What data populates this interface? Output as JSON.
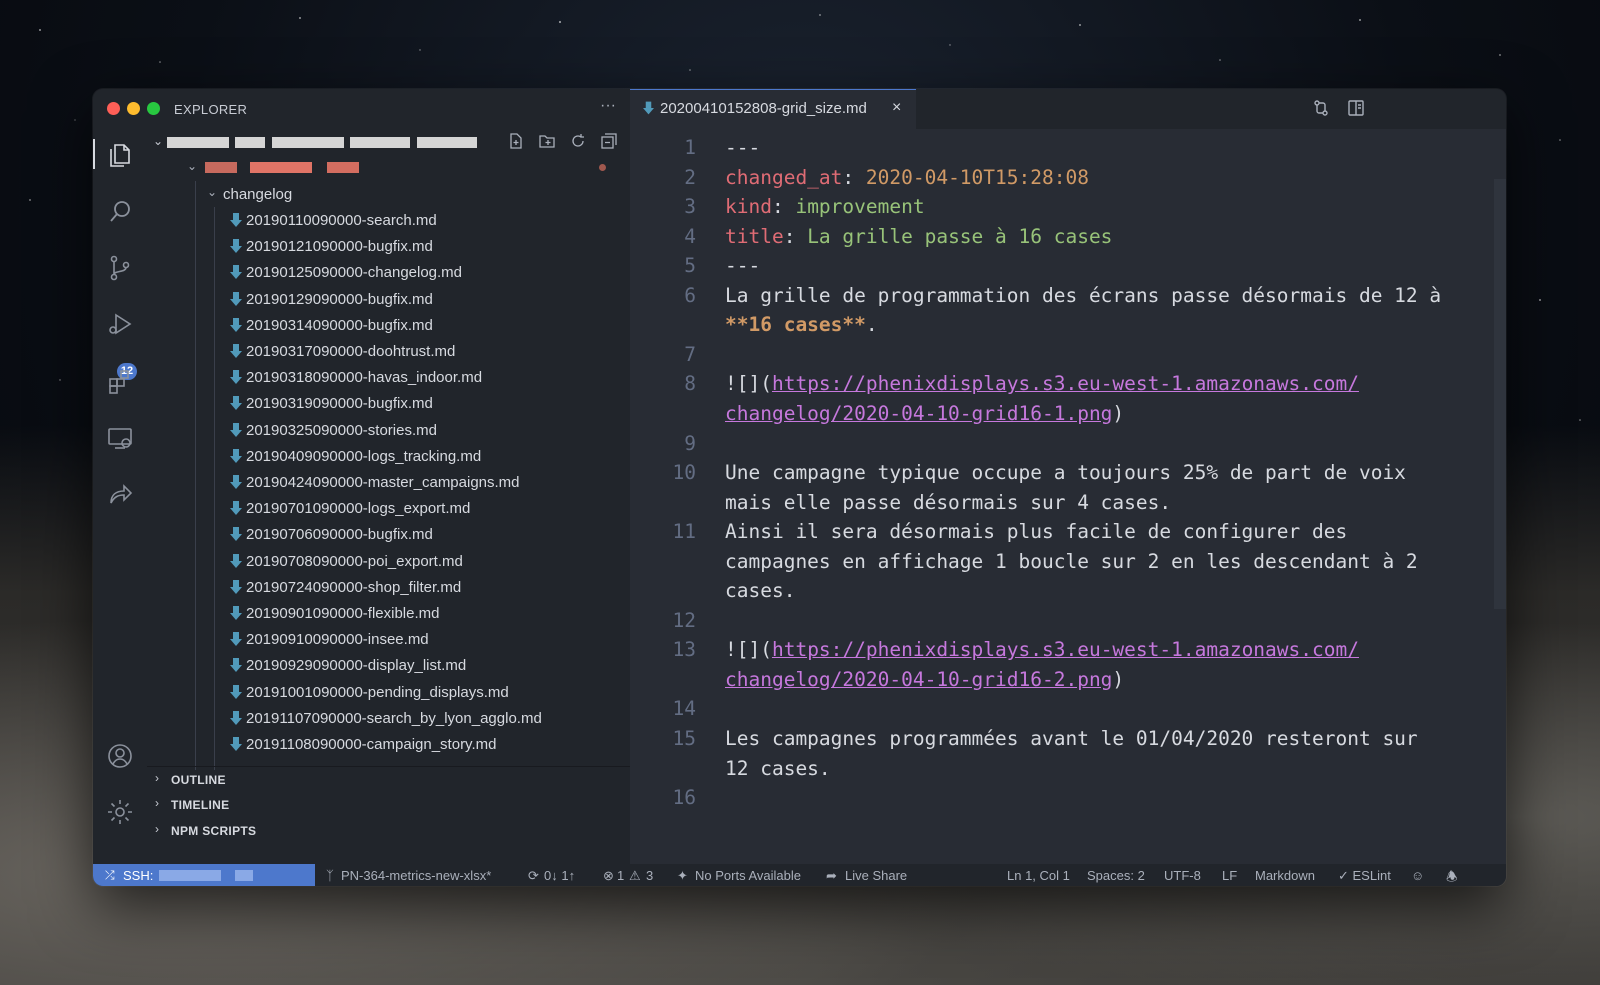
{
  "window": {
    "explorer_title": "EXPLORER",
    "more": "···"
  },
  "activity_bar": {
    "items": [
      "explorer-icon",
      "search-icon",
      "source-control-icon",
      "run-debug-icon",
      "extensions-icon",
      "remote-explorer-icon",
      "live-share-icon",
      "account-icon",
      "settings-gear-icon"
    ],
    "scm_badge": "12"
  },
  "explorer": {
    "folder": "changelog",
    "files": [
      "20190110090000-search.md",
      "20190121090000-bugfix.md",
      "20190125090000-changelog.md",
      "20190129090000-bugfix.md",
      "20190314090000-bugfix.md",
      "20190317090000-doohtrust.md",
      "20190318090000-havas_indoor.md",
      "20190319090000-bugfix.md",
      "20190325090000-stories.md",
      "20190409090000-logs_tracking.md",
      "20190424090000-master_campaigns.md",
      "20190701090000-logs_export.md",
      "20190706090000-bugfix.md",
      "20190708090000-poi_export.md",
      "20190724090000-shop_filter.md",
      "20190901090000-flexible.md",
      "20190910090000-insee.md",
      "20190929090000-display_list.md",
      "20191001090000-pending_displays.md",
      "20191107090000-search_by_lyon_agglo.md",
      "20191108090000-campaign_story.md"
    ],
    "sections": [
      "OUTLINE",
      "TIMELINE",
      "NPM SCRIPTS"
    ]
  },
  "tab": {
    "filename": "20200410152808-grid_size.md",
    "close": "×"
  },
  "editor": {
    "lines": [
      {
        "n": "1",
        "parts": [
          {
            "t": "---",
            "c": "punct"
          }
        ]
      },
      {
        "n": "2",
        "parts": [
          {
            "t": "changed_at",
            "c": "key"
          },
          {
            "t": ": ",
            "c": "punct"
          },
          {
            "t": "2020-04-10T15:28:08",
            "c": "num"
          }
        ]
      },
      {
        "n": "3",
        "parts": [
          {
            "t": "kind",
            "c": "key"
          },
          {
            "t": ": ",
            "c": "punct"
          },
          {
            "t": "improvement",
            "c": "str"
          }
        ]
      },
      {
        "n": "4",
        "parts": [
          {
            "t": "title",
            "c": "key"
          },
          {
            "t": ": ",
            "c": "punct"
          },
          {
            "t": "La grille passe à 16 cases",
            "c": "str"
          }
        ]
      },
      {
        "n": "5",
        "parts": [
          {
            "t": "---",
            "c": "punct"
          }
        ]
      },
      {
        "n": "6",
        "parts": [
          {
            "t": "La grille de programmation des écrans passe désormais de 12 à",
            "c": "punct"
          }
        ]
      },
      {
        "n": "",
        "parts": [
          {
            "t": "**16 cases**",
            "c": "bold"
          },
          {
            "t": ".",
            "c": "punct"
          }
        ]
      },
      {
        "n": "7",
        "parts": []
      },
      {
        "n": "8",
        "parts": [
          {
            "t": "![](",
            "c": "punct"
          },
          {
            "t": "https://phenixdisplays.s3.eu-west-1.amazonaws.com/",
            "c": "link"
          }
        ]
      },
      {
        "n": "",
        "parts": [
          {
            "t": "changelog/2020-04-10-grid16-1.png",
            "c": "link"
          },
          {
            "t": ")",
            "c": "punct"
          }
        ]
      },
      {
        "n": "9",
        "parts": []
      },
      {
        "n": "10",
        "parts": [
          {
            "t": "Une campagne typique occupe a toujours 25% de part de voix",
            "c": "punct"
          }
        ]
      },
      {
        "n": "",
        "parts": [
          {
            "t": "mais elle passe désormais sur 4 cases.",
            "c": "punct"
          }
        ]
      },
      {
        "n": "11",
        "parts": [
          {
            "t": "Ainsi il sera désormais plus facile de configurer des",
            "c": "punct"
          }
        ]
      },
      {
        "n": "",
        "parts": [
          {
            "t": "campagnes en affichage 1 boucle sur 2 en les descendant à 2",
            "c": "punct"
          }
        ]
      },
      {
        "n": "",
        "parts": [
          {
            "t": "cases.",
            "c": "punct"
          }
        ]
      },
      {
        "n": "12",
        "parts": []
      },
      {
        "n": "13",
        "parts": [
          {
            "t": "![](",
            "c": "punct"
          },
          {
            "t": "https://phenixdisplays.s3.eu-west-1.amazonaws.com/",
            "c": "link"
          }
        ]
      },
      {
        "n": "",
        "parts": [
          {
            "t": "changelog/2020-04-10-grid16-2.png",
            "c": "link"
          },
          {
            "t": ")",
            "c": "punct"
          }
        ]
      },
      {
        "n": "14",
        "parts": []
      },
      {
        "n": "15",
        "parts": [
          {
            "t": "Les campagnes programmées avant le 01/04/2020 resteront sur",
            "c": "punct"
          }
        ]
      },
      {
        "n": "",
        "parts": [
          {
            "t": "12 cases.",
            "c": "punct"
          }
        ]
      },
      {
        "n": "16",
        "parts": []
      }
    ]
  },
  "status": {
    "ssh": "SSH:",
    "branch": "PN-364-metrics-new-xlsx*",
    "sync": "0↓ 1↑",
    "errors": "1",
    "warnings": "3",
    "ports": "No Ports Available",
    "live_share": "Live Share",
    "position": "Ln 1, Col 1",
    "spaces": "Spaces: 2",
    "encoding": "UTF-8",
    "eol": "LF",
    "language": "Markdown",
    "eslint": "✓ ESLint"
  }
}
